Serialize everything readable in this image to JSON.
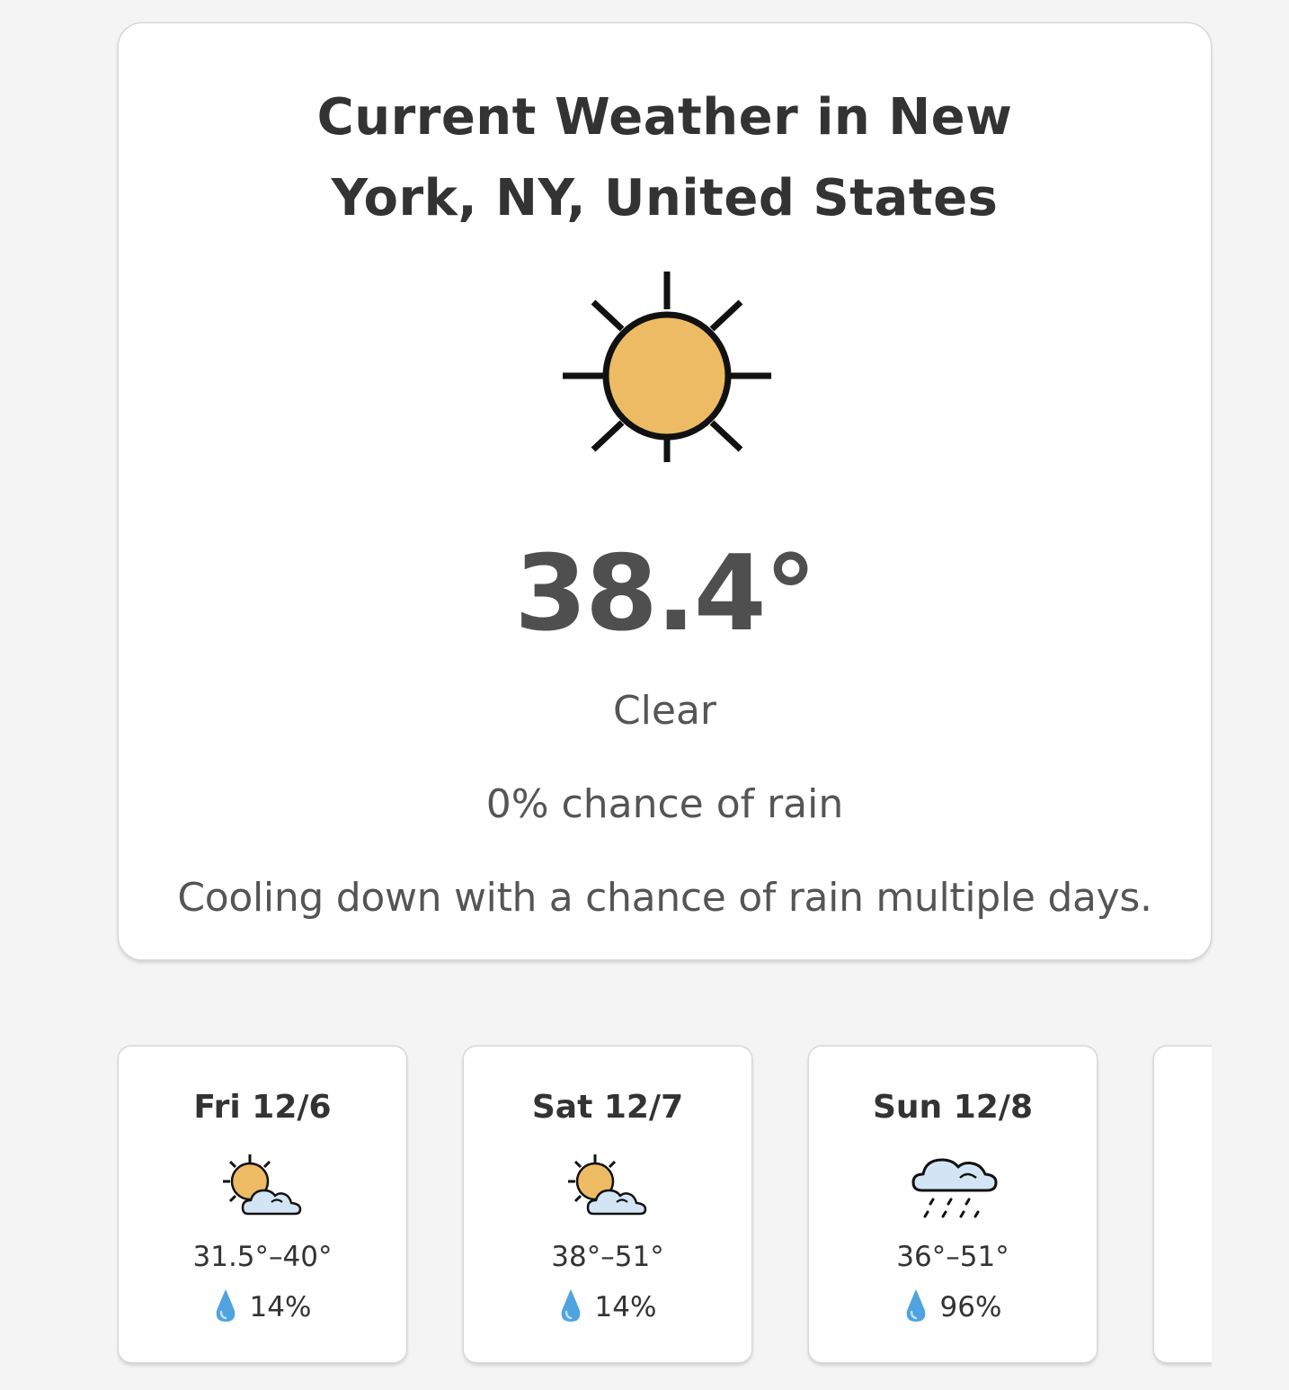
{
  "current": {
    "title_line1": "Current Weather in New",
    "title_line2": "York, NY, United States",
    "icon": "sun-icon",
    "temperature": "38.4°",
    "condition": "Clear",
    "rain_chance": "0% chance of rain",
    "summary": "Cooling down with a chance of rain multiple days."
  },
  "forecast": [
    {
      "day": "Fri 12/6",
      "icon": "partly-cloudy-icon",
      "range": "31.5°–40°",
      "precip": "14%"
    },
    {
      "day": "Sat 12/7",
      "icon": "partly-cloudy-icon",
      "range": "38°–51°",
      "precip": "14%"
    },
    {
      "day": "Sun 12/8",
      "icon": "rain-cloud-icon",
      "range": "36°–51°",
      "precip": "96%"
    }
  ],
  "colors": {
    "sun": "#EDBB63",
    "cloud": "#D3E5F5",
    "drop": "#4FA3E0",
    "text_dark": "#333333",
    "text_muted": "#555555"
  }
}
